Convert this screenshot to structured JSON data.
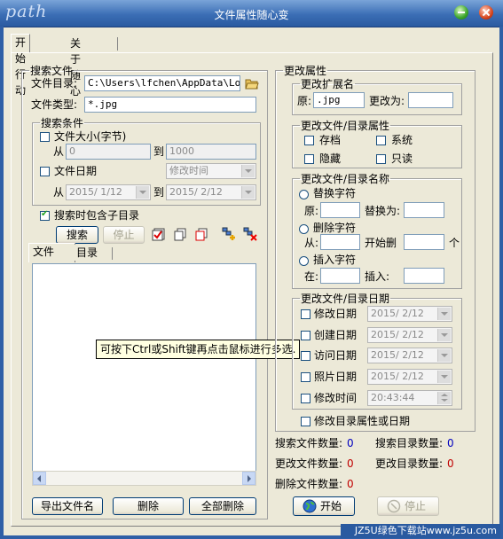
{
  "window": {
    "logo": "path",
    "title": "文件属性随心变"
  },
  "tabs": [
    "开始行动",
    "关于随心"
  ],
  "search": {
    "group": "搜索文件",
    "dir_label": "文件目录:",
    "dir_value": "C:\\Users\\lfchen\\AppData\\Local",
    "type_label": "文件类型:",
    "type_value": "*.jpg",
    "conditions": {
      "group": "搜索条件",
      "size_label": "文件大小(字节)",
      "from": "从",
      "to": "到",
      "size_from": "0",
      "size_to": "1000",
      "date_label": "文件日期",
      "date_mode": "修改时间",
      "date_from": "2015/ 1/12",
      "date_to": "2015/ 2/12"
    },
    "subdir_label": "搜索时包含子目录",
    "search_btn": "搜索",
    "stop_btn": "停止"
  },
  "list_tabs": [
    "文件",
    "目录"
  ],
  "tooltip": "可按下Ctrl或Shift键再点击鼠标进行多选.",
  "bottom_buttons": {
    "export": "导出文件名",
    "delete": "删除",
    "delete_all": "全部删除"
  },
  "modify": {
    "group": "更改属性",
    "ext": {
      "group": "更改扩展名",
      "orig_label": "原:",
      "orig_value": ".jpg",
      "new_label": "更改为:"
    },
    "attr": {
      "group": "更改文件/目录属性",
      "archive": "存档",
      "system": "系统",
      "hidden": "隐藏",
      "readonly": "只读"
    },
    "name": {
      "group": "更改文件/目录名称",
      "replace": "替换字符",
      "orig": "原:",
      "replace_with": "替换为:",
      "delete": "删除字符",
      "from": "从:",
      "start_delete": "开始删",
      "unit": "个",
      "insert": "插入字符",
      "at": "在:",
      "insert_label": "插入:"
    },
    "date": {
      "group": "更改文件/目录日期",
      "rows": [
        {
          "label": "修改日期",
          "value": "2015/ 2/12"
        },
        {
          "label": "创建日期",
          "value": "2015/ 2/12"
        },
        {
          "label": "访问日期",
          "value": "2015/ 2/12"
        },
        {
          "label": "照片日期",
          "value": "2015/ 2/12"
        },
        {
          "label": "修改时间",
          "value": "20:43:44"
        }
      ]
    },
    "dir_attr_label": "修改目录属性或日期"
  },
  "stats": {
    "search_files_label": "搜索文件数量:",
    "search_files": "0",
    "search_dirs_label": "搜索目录数量:",
    "search_dirs": "0",
    "changed_files_label": "更改文件数量:",
    "changed_files": "0",
    "changed_dirs_label": "更改目录数量:",
    "changed_dirs": "0",
    "deleted_files_label": "删除文件数量:",
    "deleted_files": "0"
  },
  "actions": {
    "start": "开始",
    "stop": "停止"
  },
  "watermark": "JZ5U绿色下载站www.jz5u.com"
}
